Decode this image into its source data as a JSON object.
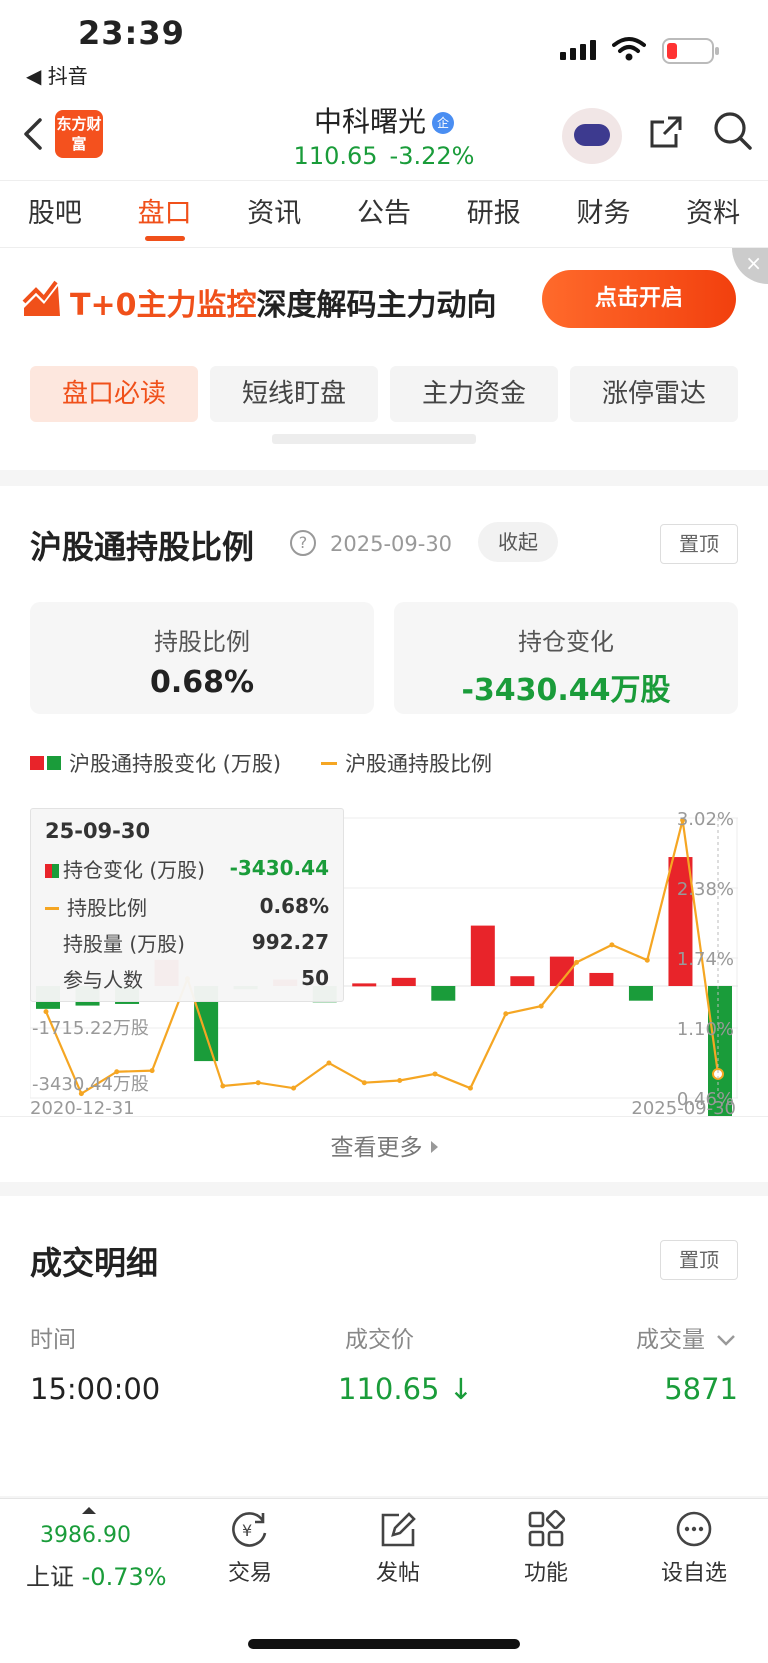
{
  "status_bar": {
    "time": "23:39",
    "back_app": "◀ 抖音"
  },
  "header": {
    "brand": "东方财富",
    "stock_name": "中科曙光",
    "price": "110.65",
    "change": "-3.22%"
  },
  "tabs": [
    "股吧",
    "盘口",
    "资讯",
    "公告",
    "研报",
    "财务",
    "资料"
  ],
  "promo": {
    "text_highlight": "T+0主力监控",
    "text_rest": "深度解码主力动向",
    "button": "点击开启",
    "close": "×"
  },
  "sub_tabs": [
    "盘口必读",
    "短线盯盘",
    "主力资金",
    "涨停雷达"
  ],
  "hk_section": {
    "title": "沪股通持股比例",
    "help": "?",
    "date": "2025-09-30",
    "collapse": "收起",
    "pin": "置顶",
    "cards": [
      {
        "label": "持股比例",
        "value": "0.68%"
      },
      {
        "label": "持仓变化",
        "value": "-3430.44万股"
      }
    ],
    "legend": {
      "bar_series": "沪股通持股变化 (万股)",
      "line_series": "沪股通持股比例"
    },
    "tooltip": {
      "date": "25-09-30",
      "rows": [
        {
          "label": "持仓变化 (万股)",
          "value": "-3430.44"
        },
        {
          "label": "持股比例",
          "value": "0.68%"
        },
        {
          "label": "持股量 (万股)",
          "value": "992.27"
        },
        {
          "label": "参与人数",
          "value": "50"
        }
      ]
    },
    "more": "查看更多"
  },
  "chart_data": {
    "type": "bar",
    "x_start_label": "2020-12-31",
    "x_end_label": "2025-09-30",
    "left_axis_ticks": [
      "-1715.22万股",
      "-3430.44万股"
    ],
    "right_axis_ticks": [
      "3.02%",
      "2.38%",
      "1.74%",
      "1.10%",
      "0.46%"
    ],
    "ylim_shares": [
      -3430.44,
      5145.66
    ],
    "ylim_ratio": [
      0.46,
      3.02
    ],
    "series": [
      {
        "name": "沪股通持股变化 (万股)",
        "type": "bar",
        "values": [
          -700,
          -600,
          -550,
          800,
          -2300,
          -100,
          200,
          -500,
          80,
          250,
          -450,
          1850,
          300,
          900,
          400,
          -450,
          3950,
          -5100
        ]
      },
      {
        "name": "沪股通持股比例",
        "type": "line",
        "values": [
          1.25,
          0.5,
          0.7,
          0.71,
          1.55,
          0.57,
          0.6,
          0.55,
          0.78,
          0.6,
          0.62,
          0.68,
          0.55,
          1.23,
          1.3,
          1.7,
          1.86,
          1.72,
          3.0,
          0.68
        ]
      }
    ]
  },
  "trade_detail": {
    "title": "成交明细",
    "pin": "置顶",
    "headers": [
      "时间",
      "成交价",
      "成交量"
    ],
    "row": {
      "time": "15:00:00",
      "price": "110.65 ↓",
      "volume": "5871"
    }
  },
  "bottom_bar": {
    "index_value": "3986.90",
    "index_name": "上证",
    "index_change": "-0.73%",
    "nav": [
      "交易",
      "发帖",
      "功能",
      "设自选"
    ]
  },
  "colors": {
    "accent": "#f0501a",
    "up": "#e8242a",
    "down": "#1a9c3a",
    "line": "#f5a623"
  }
}
